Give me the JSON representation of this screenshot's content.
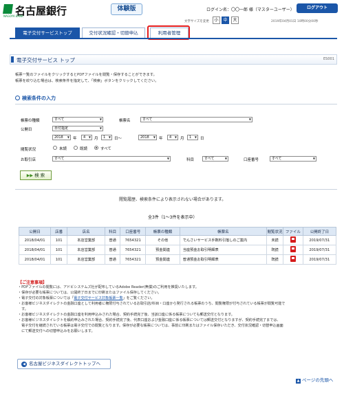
{
  "header": {
    "bank_name": "名古屋銀行",
    "bank_sub": "NAGOYA BANK",
    "trial_label": "体験版",
    "login_user": "ログイン名：〇〇一郎 様（マスターユーザー）",
    "logout_label": "ログアウト",
    "font_size_label": "文字サイズを変更",
    "font_sizes": [
      "小",
      "中",
      "大"
    ],
    "datetime": "2019年04月01日 10時00分00秒"
  },
  "tabs": [
    {
      "label": "電子交付サービストップ"
    },
    {
      "label": "交付状況確認・切替申込"
    },
    {
      "label": "利用者管理"
    }
  ],
  "page": {
    "title": "電子交付サービス トップ",
    "code": "ES001",
    "desc1": "帳票一覧のファイルをクリックするとPDFファイルを閲覧・保存することができます。",
    "desc2": "帳票を絞り込む場合は、検索条件を指定して、「検索」ボタンをクリックしてください。"
  },
  "search": {
    "heading": "検索条件の入力",
    "doc_type_label": "帳票の種類",
    "doc_type_value": "すべて",
    "doc_name_label": "帳票名",
    "doc_name_value": "すべて",
    "date_label": "公開日",
    "date_mode": "日付指定",
    "from_year": "2018",
    "from_month": "4",
    "from_day": "1",
    "to_year": "2018",
    "to_month": "4",
    "to_day": "1",
    "year_unit": "年",
    "month_unit": "月",
    "day_unit": "日",
    "range_sep": "日～",
    "status_label": "閲覧状況",
    "status_options": [
      "未読",
      "既読",
      "すべて"
    ],
    "branch_label": "お取引店",
    "branch_value": "すべて",
    "subject_label": "科目",
    "subject_value": "すべて",
    "account_label": "口座番号",
    "account_value": "すべて",
    "button_label": "検 索"
  },
  "results": {
    "note": "閲覧履歴、検索条件により表示されない場合があります。",
    "count": "全3件（1～3件を表示中）",
    "columns": [
      "公開日",
      "店番",
      "店名",
      "科目",
      "口座番号",
      "帳票の種類",
      "帳票名",
      "閲覧状況",
      "ファイル",
      "公開終了日"
    ],
    "rows": [
      [
        "2018/04/01",
        "101",
        "本店営業部",
        "普通",
        "7654321",
        "その他",
        "でんさいサービス手数料引落しのご案内",
        "未読",
        "",
        "2019/07/31"
      ],
      [
        "2018/04/01",
        "101",
        "本店営業部",
        "普通",
        "7654321",
        "預金関連",
        "当座預金お取引明細表",
        "既読",
        "",
        "2019/07/31"
      ],
      [
        "2018/04/01",
        "101",
        "本店営業部",
        "普通",
        "7654321",
        "預金関連",
        "普通預金お取引明細表",
        "既読",
        "",
        "2019/07/31"
      ]
    ]
  },
  "notes": {
    "heading": "【ご注意事項】",
    "lines": [
      "・PDFファイルの閲覧には、アドビシステムズ社が配布しているAdobe Reader(無償)のご利用を推奨いたします。",
      "・保存が必要な帳票については、公開終了日までに印刷またはファイル保存してください。",
      "・電子交付の対象帳票については「",
      "・お客様ビジネスダイレクトの金融口座として利用者に権限付与されているお取引店/科目・口座から発行される帳票のうち、閲覧権限が付与されている帳票が閲覧可能で",
      "　す。",
      "・お客様ビジネスダイレクトの金融口座を利用申込みされた場合、契約手続完了後、当該口座に係る帳票についても郵送交付となります。",
      "・お客様ビジネスダイレクトを解約申込みされた場合、契約手続完了後、代表口座および金融口座に係る帳票については郵送交付となりますが、契約手続完了までは、",
      "　電子交付を継続されている帳票は電子交付での閲覧となります。保存が必要な帳票については、事前に印刷またはファイル保存いただき、交付状況確認・切替申込画面",
      "　にて郵送交付への切替申込みをお願いします。"
    ],
    "link_text": "電子交付サービス対象帳票一覧",
    "link_after": "」をご覧ください。"
  },
  "footer": {
    "back_label": "名古屋ビジネスダイレクトトップへ",
    "top_label": "ページの先頭へ"
  },
  "colors": {
    "brand": "#1b56a8",
    "logo_green": "#0a8a3a",
    "highlight": "#e41c1c"
  }
}
